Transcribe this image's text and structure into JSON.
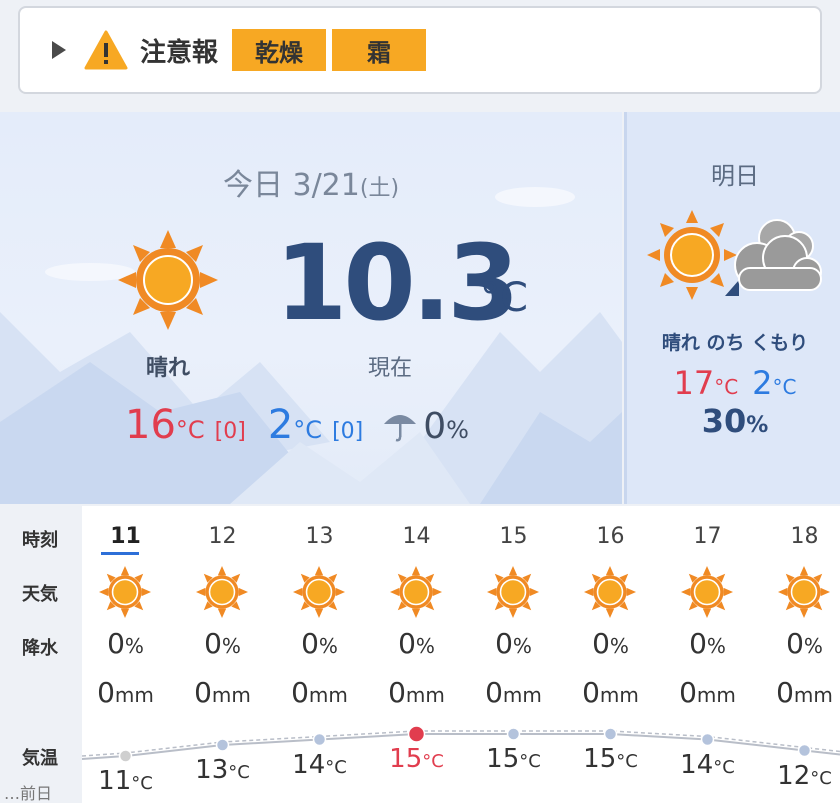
{
  "warning": {
    "title": "注意報",
    "badges": [
      "乾燥",
      "霜"
    ]
  },
  "today": {
    "date_label": "今日 3/21",
    "dow": "(土)",
    "weather": "晴れ",
    "current_temp": "10.3",
    "unit": "°C",
    "now_label": "現在",
    "high": "16",
    "high_diff": "[0]",
    "low": "2",
    "low_diff": "[0]",
    "rain_prob": "0",
    "pct": "%"
  },
  "tomorrow": {
    "title": "明日",
    "weather": "晴れ のち くもり",
    "high": "17",
    "low": "2",
    "rain_prob": "30",
    "pct": "%"
  },
  "hourly": {
    "labels": {
      "time": "時刻",
      "weather": "天気",
      "precip": "降水",
      "temp": "気温",
      "prev": "…前日"
    },
    "hours": [
      {
        "hour": "11",
        "rain": "0",
        "mm": "0",
        "temp": "11"
      },
      {
        "hour": "12",
        "rain": "0",
        "mm": "0",
        "temp": "13"
      },
      {
        "hour": "13",
        "rain": "0",
        "mm": "0",
        "temp": "14"
      },
      {
        "hour": "14",
        "rain": "0",
        "mm": "0",
        "temp": "15"
      },
      {
        "hour": "15",
        "rain": "0",
        "mm": "0",
        "temp": "15"
      },
      {
        "hour": "16",
        "rain": "0",
        "mm": "0",
        "temp": "15"
      },
      {
        "hour": "17",
        "rain": "0",
        "mm": "0",
        "temp": "14"
      },
      {
        "hour": "18",
        "rain": "0",
        "mm": "0",
        "temp": "12"
      }
    ],
    "mm_unit": "mm",
    "pct_unit": "%",
    "temp_unit": "°C",
    "current_index": 0,
    "max_index": 3
  },
  "colors": {
    "accent_orange": "#f7a823",
    "hot_red": "#e13d4e",
    "cold_blue": "#2d7be0",
    "navy": "#2f4d7c"
  },
  "icons": {
    "warning": "warning-triangle-icon",
    "sun": "sun-icon",
    "cloud": "cloud-icon",
    "umbrella": "umbrella-icon",
    "expand": "chevron-right-icon"
  }
}
